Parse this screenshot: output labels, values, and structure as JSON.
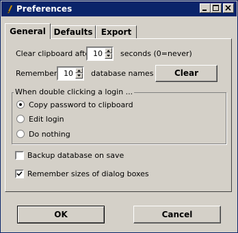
{
  "window": {
    "title": "Preferences"
  },
  "titlebar_buttons": [
    "minimize",
    "maximize",
    "close"
  ],
  "tabs": [
    {
      "label": "General",
      "active": true
    },
    {
      "label": "Defaults",
      "active": false
    },
    {
      "label": "Export",
      "active": false
    }
  ],
  "general": {
    "clear_clipboard_label": "Clear clipboard after",
    "clear_clipboard_value": "10",
    "clear_clipboard_suffix": "seconds (0=never)",
    "remember_label": "Remember",
    "remember_value": "10",
    "remember_suffix": "database names",
    "clear_button": "Clear",
    "double_click_group": {
      "title": "When double clicking a login ...",
      "options": [
        {
          "label": "Copy password to clipboard",
          "selected": true
        },
        {
          "label": "Edit login",
          "selected": false
        },
        {
          "label": "Do nothing",
          "selected": false
        }
      ]
    },
    "backup_label": "Backup database on save",
    "backup_checked": false,
    "remember_sizes_label": "Remember sizes of dialog boxes",
    "remember_sizes_checked": true
  },
  "buttons": {
    "ok": "OK",
    "cancel": "Cancel"
  }
}
